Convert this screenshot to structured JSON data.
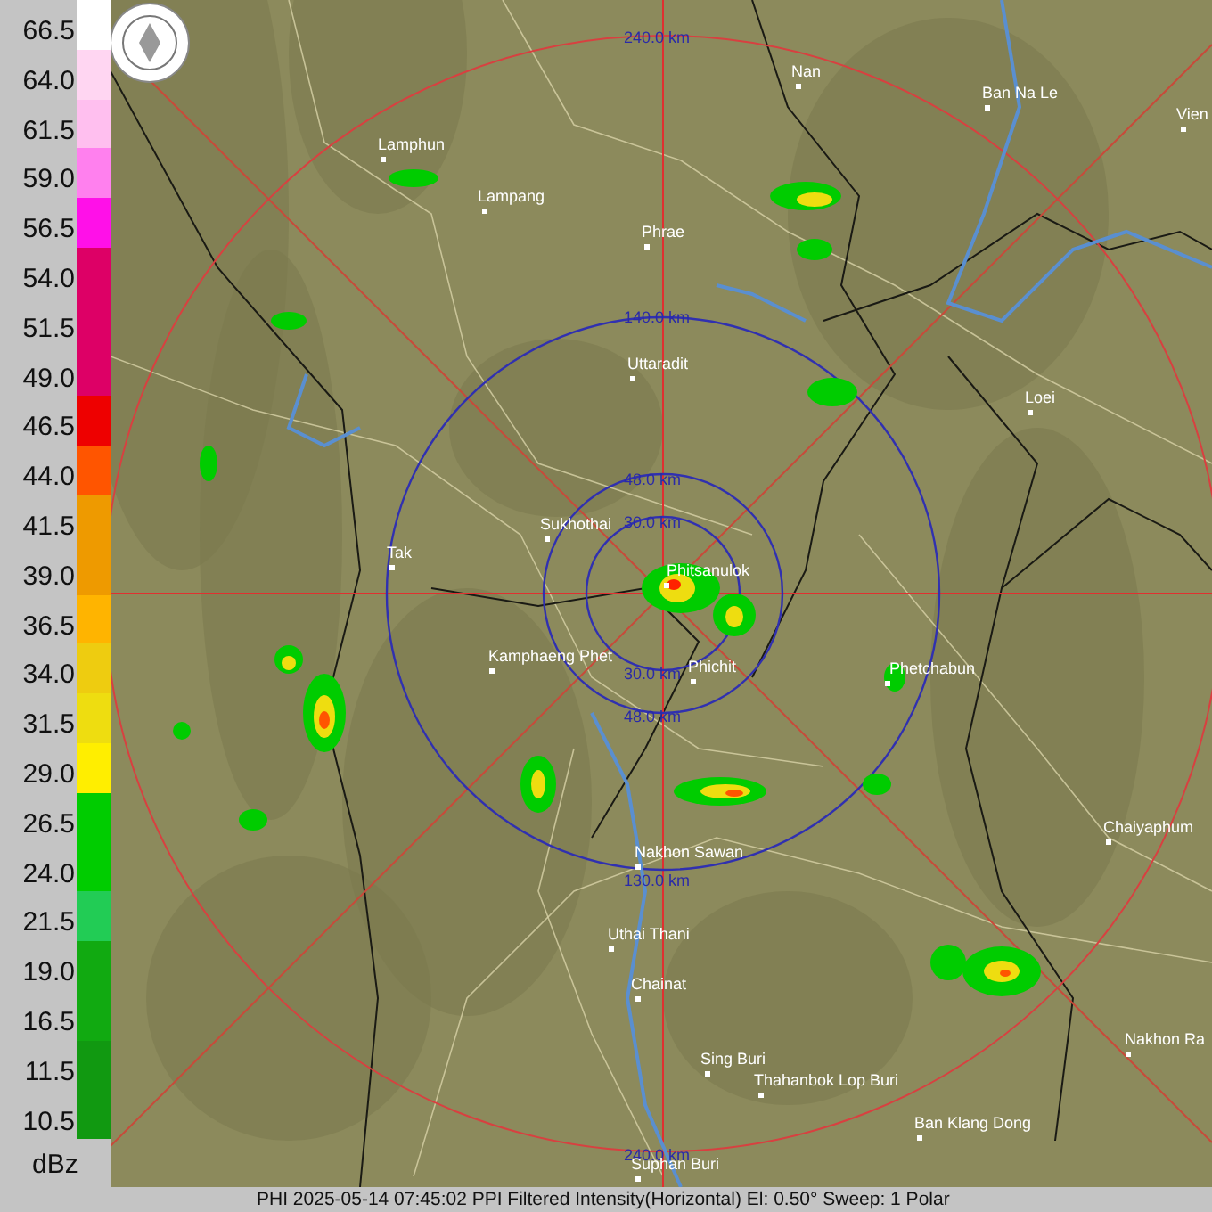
{
  "legend": {
    "items": [
      {
        "label": "66.5",
        "color": "#ffffff"
      },
      {
        "label": "64.0",
        "color": "#ffd6f2"
      },
      {
        "label": "61.5",
        "color": "#ffbfef"
      },
      {
        "label": "59.0",
        "color": "#ff80ee"
      },
      {
        "label": "56.5",
        "color": "#ff10e8"
      },
      {
        "label": "54.0",
        "color": "#dd0066"
      },
      {
        "label": "51.5",
        "color": "#dd0066"
      },
      {
        "label": "49.0",
        "color": "#dd0066"
      },
      {
        "label": "46.5",
        "color": "#ee0000"
      },
      {
        "label": "44.0",
        "color": "#ff5500"
      },
      {
        "label": "41.5",
        "color": "#ee9a00"
      },
      {
        "label": "39.0",
        "color": "#ee9a00"
      },
      {
        "label": "36.5",
        "color": "#ffb400"
      },
      {
        "label": "34.0",
        "color": "#eecc10"
      },
      {
        "label": "31.5",
        "color": "#eedd10"
      },
      {
        "label": "29.0",
        "color": "#ffee00"
      },
      {
        "label": "26.5",
        "color": "#00cc00"
      },
      {
        "label": "24.0",
        "color": "#00cc00"
      },
      {
        "label": "21.5",
        "color": "#22cc55"
      },
      {
        "label": "19.0",
        "color": "#11aa11"
      },
      {
        "label": "16.5",
        "color": "#11aa11"
      },
      {
        "label": "11.5",
        "color": "#119911"
      },
      {
        "label": "10.5",
        "color": "#119911"
      }
    ],
    "unit": "dBz"
  },
  "map": {
    "ring_labels": [
      "240.0 km",
      "140.0 km",
      "48.0 km",
      "30.0 km",
      "30.0 km",
      "48.0 km",
      "130.0 km",
      "240.0 km"
    ],
    "cities": [
      "Nan",
      "Ban Na Le",
      "Vien",
      "Lamphun",
      "Lampang",
      "Phrae",
      "Uttaradit",
      "Loei",
      "Sukhothai",
      "Phitsanulok",
      "Tak",
      "Kamphaeng Phet",
      "Phichit",
      "Phetchabun",
      "Nakhon Sawan",
      "Chaiyaphum",
      "Uthai Thani",
      "Chainat",
      "Sing Buri",
      "Thahanbok Lop Buri",
      "Ban Klang Dong",
      "Nakhon Ra",
      "Suphan Buri"
    ]
  },
  "status_bar": "PHI 2025-05-14 07:45:02 PPI Filtered Intensity(Horizontal)  El: 0.50°  Sweep: 1 Polar"
}
